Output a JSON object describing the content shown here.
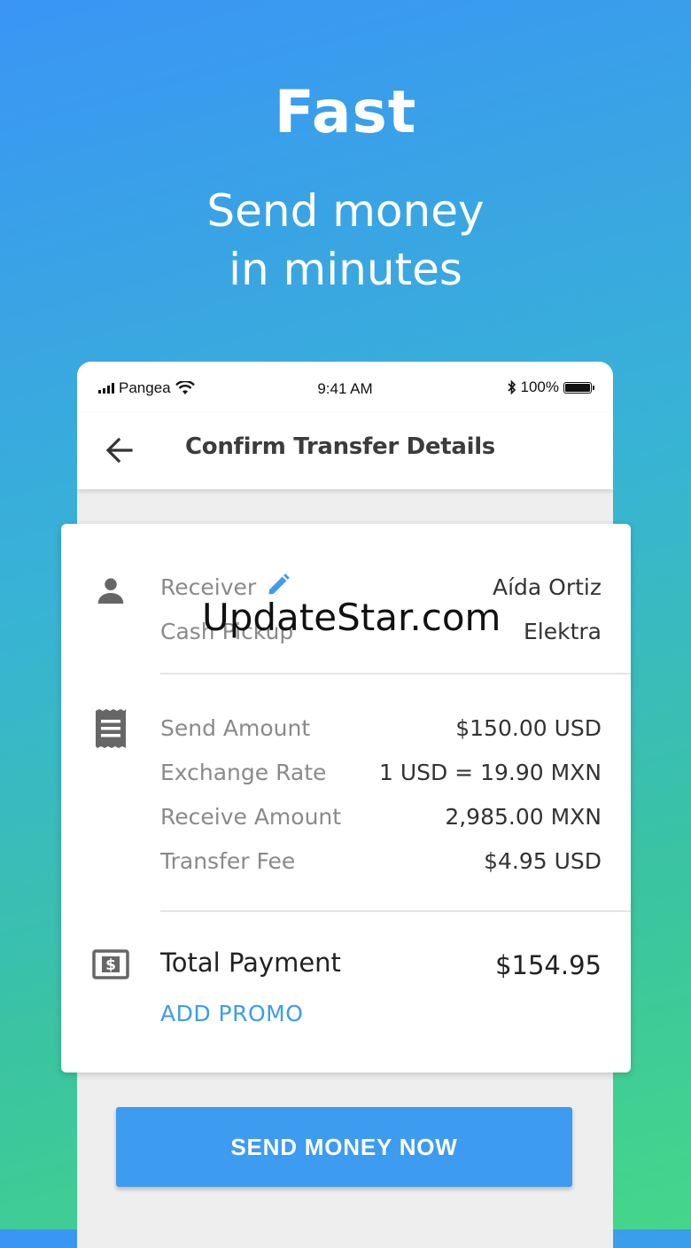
{
  "hero": {
    "title": "Fast",
    "subtitle_line1": "Send money",
    "subtitle_line2": "in minutes"
  },
  "status_bar": {
    "carrier": "Pangea",
    "time": "9:41 AM",
    "battery": "100%"
  },
  "app_bar": {
    "title": "Confirm Transfer Details",
    "back_icon": "arrow-left-icon"
  },
  "receiver": {
    "label": "Receiver",
    "name": "Aída Ortiz",
    "method_label": "Cash Pickup",
    "method_value": "Elektra",
    "edit_icon": "pencil-icon"
  },
  "details": [
    {
      "label": "Send Amount",
      "value": "$150.00 USD"
    },
    {
      "label": "Exchange Rate",
      "value": "1 USD = 19.90 MXN"
    },
    {
      "label": "Receive Amount",
      "value": "2,985.00 MXN"
    },
    {
      "label": "Transfer Fee",
      "value": "$4.95 USD"
    }
  ],
  "total": {
    "label": "Total Payment",
    "value": "$154.95",
    "promo": "ADD PROMO"
  },
  "watermark": "UpdateStar.com",
  "actions": {
    "send_button": "SEND MONEY NOW"
  },
  "colors": {
    "accent": "#3d9bf0",
    "gradient_top": "#3a95f5",
    "gradient_bottom": "#45d68a"
  }
}
